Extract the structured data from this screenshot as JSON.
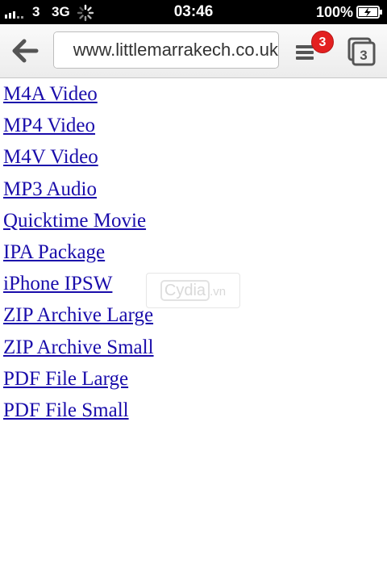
{
  "status_bar": {
    "carrier": "3",
    "network": "3G",
    "time": "03:46",
    "battery_percent": "100%"
  },
  "toolbar": {
    "url": "www.littlemarrakech.co.uk",
    "menu_badge_count": "3",
    "tab_count": "3"
  },
  "links": [
    "M4A Video",
    "MP4 Video",
    "M4V Video",
    "MP3 Audio",
    "Quicktime Movie",
    "IPA Package",
    "iPhone IPSW",
    "ZIP Archive Large",
    "ZIP Archive Small",
    "PDF File Large",
    "PDF File Small"
  ],
  "watermark": {
    "brand": "Cydia",
    "tld": ".vn"
  },
  "colors": {
    "link": "#1a0dab",
    "badge": "#e32020",
    "status_bar_bg": "#000000"
  }
}
